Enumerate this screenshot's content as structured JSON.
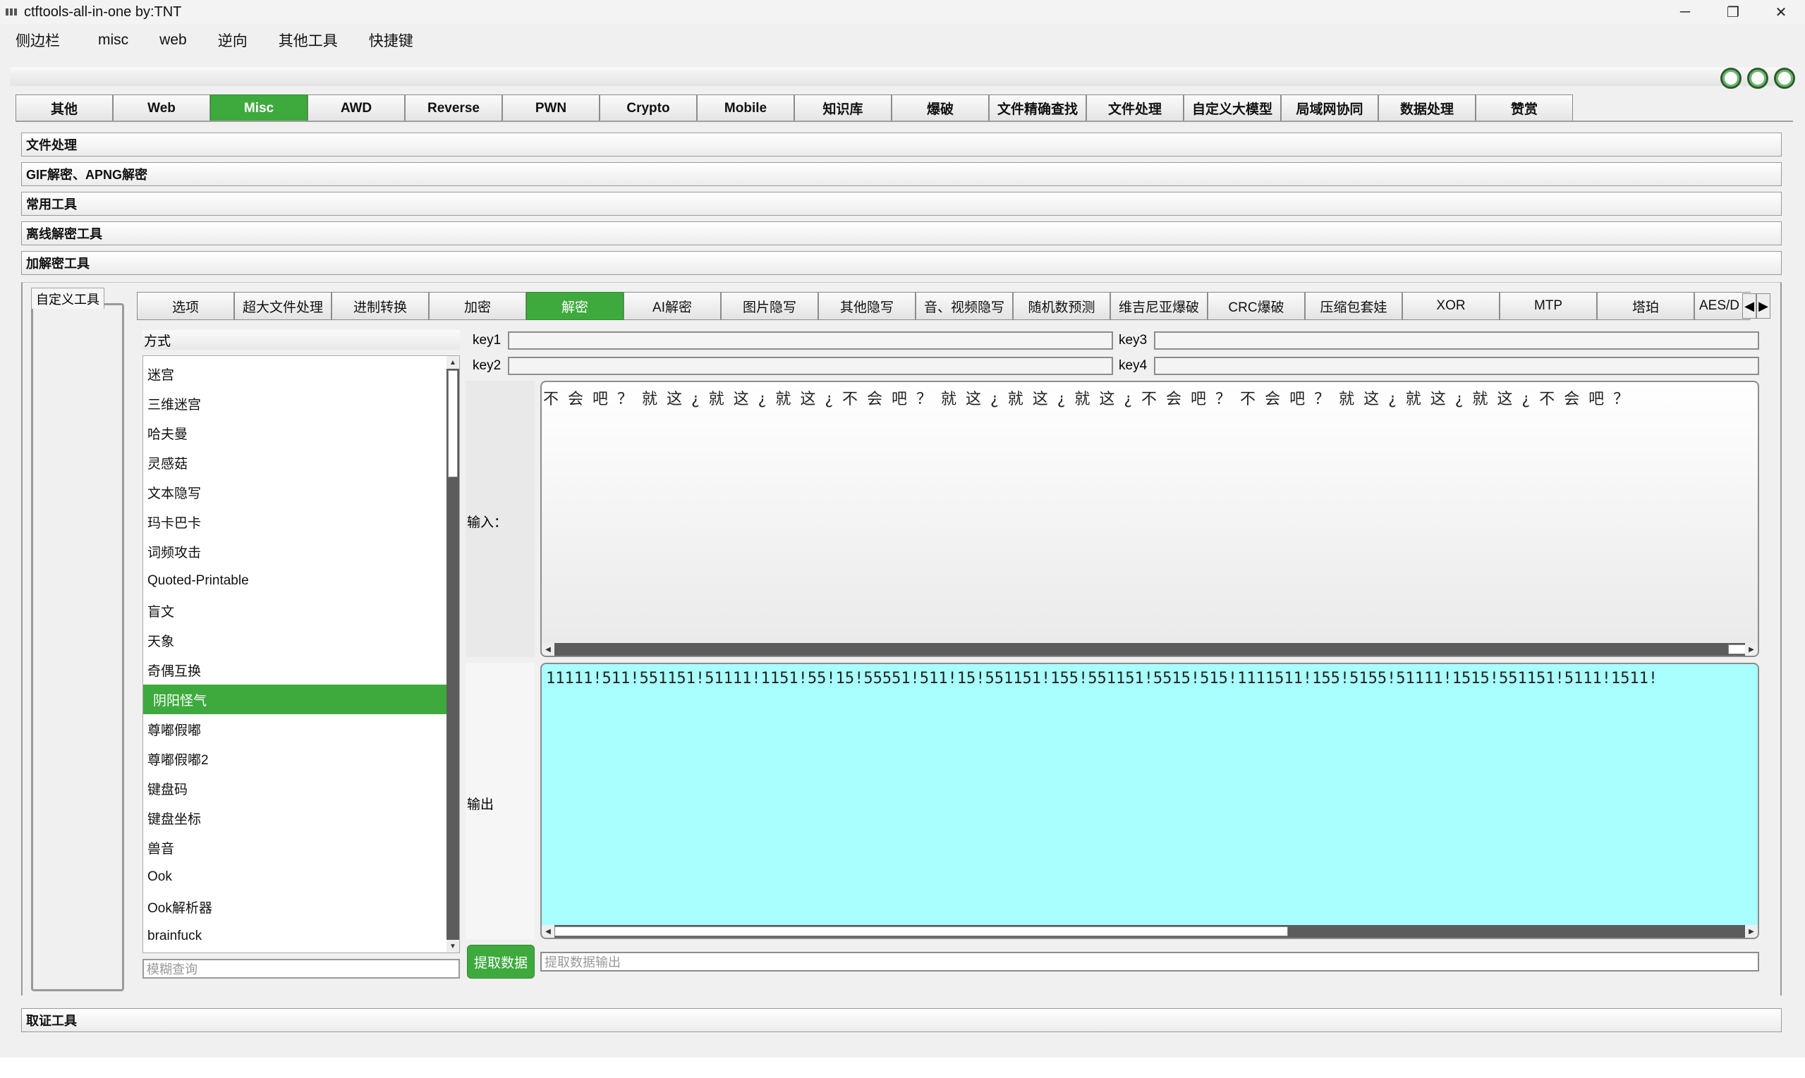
{
  "window": {
    "title": "ctftools-all-in-one   by:TNT",
    "controls": [
      "─",
      "❐",
      "✕"
    ]
  },
  "menu": [
    "侧边栏",
    "misc",
    "web",
    "逆向",
    "其他工具",
    "快捷键"
  ],
  "main_tabs": [
    "其他",
    "Web",
    "Misc",
    "AWD",
    "Reverse",
    "PWN",
    "Crypto",
    "Mobile",
    "知识库",
    "爆破",
    "文件精确查找",
    "文件处理",
    "自定义大模型",
    "局域网协同",
    "数据处理",
    "赞赏"
  ],
  "main_tab_active": "Misc",
  "sections": [
    "文件处理",
    "GIF解密、APNG解密",
    "常用工具",
    "离线解密工具",
    "加解密工具"
  ],
  "custom_tool_label": "自定义工具",
  "sub_tabs": [
    "选项",
    "超大文件处理",
    "进制转换",
    "加密",
    "解密",
    "AI解密",
    "图片隐写",
    "其他隐写",
    "音、视频隐写",
    "随机数预测",
    "维吉尼亚爆破",
    "CRC爆破",
    "压缩包套娃",
    "XOR",
    "MTP",
    "塔珀",
    "AES/D"
  ],
  "sub_tab_active": "解密",
  "method": {
    "label": "方式",
    "items": [
      "迷宫",
      "三维迷宫",
      "哈夫曼",
      "灵感菇",
      "文本隐写",
      "玛卡巴卡",
      "词频攻击",
      "Quoted-Printable",
      "盲文",
      "天象",
      "奇偶互换",
      "阴阳怪气",
      "尊嘟假嘟",
      "尊嘟假嘟2",
      "键盘码",
      "键盘坐标",
      "兽音",
      "Ook",
      "Ook解析器",
      "brainfuck"
    ],
    "selected": "阴阳怪气",
    "search_placeholder": "模糊查询"
  },
  "keys": {
    "key1": "key1",
    "key2": "key2",
    "key3": "key3",
    "key4": "key4"
  },
  "input_label": "输入：",
  "input_text": "不会吧？就这¿就这¿就这¿不会吧？就这¿就这¿就这¿不会吧？不会吧？就这¿就这¿就这¿不会吧？",
  "output_label": "输出",
  "output_text": "11111!511!551151!51111!1151!55!15!55551!511!15!551151!155!551151!5515!515!1111511!155!5155!51111!1515!551151!5111!1511!",
  "extract_button": "提取数据",
  "extract_placeholder": "提取数据输出",
  "forensics_section": "取证工具",
  "colors": {
    "accent": "#3eaa3e",
    "output_bg": "#a8fffd"
  }
}
